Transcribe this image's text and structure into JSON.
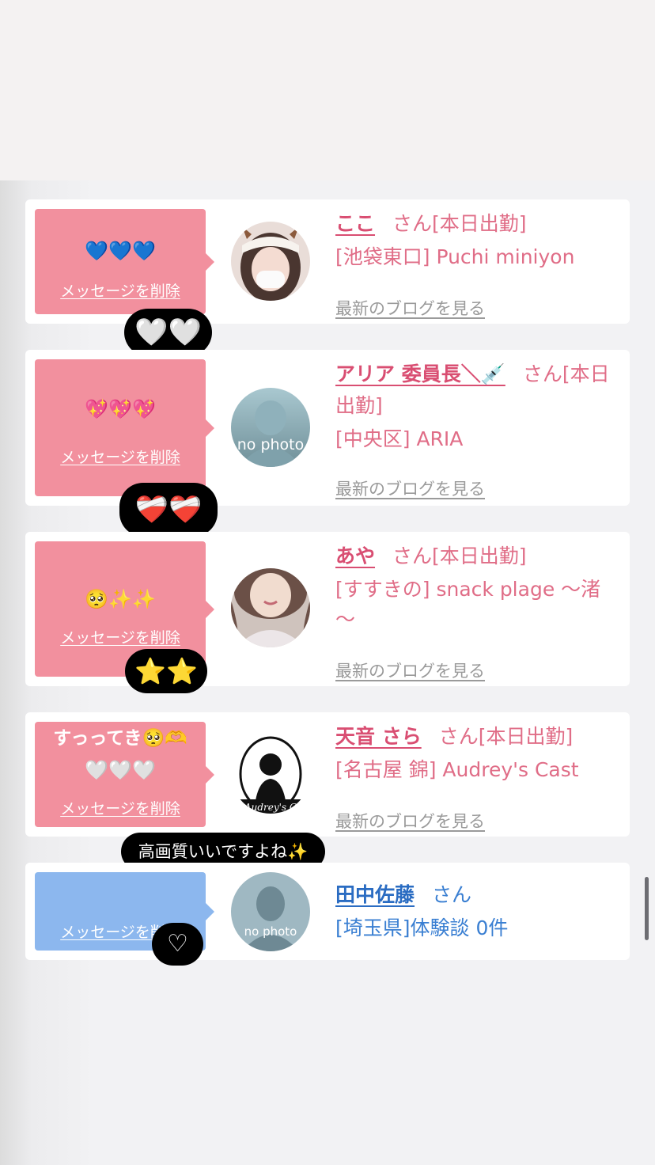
{
  "cards": [
    {
      "message": "💙💙💙",
      "delete_label": "メッセージを削除",
      "name": "ここ",
      "suffix": "さん[本日出勤]",
      "shop": "[池袋東口] Puchi miniyon",
      "blog_link": "最新のブログを見る",
      "reaction": "🤍🤍",
      "avatar": "photo-avatar"
    },
    {
      "message": "💖💖💖",
      "delete_label": "メッセージを削除",
      "name": "アリア 委員長＼💉",
      "suffix": "さん[本日",
      "suffix_cont": "出勤]",
      "shop": "[中央区] ARIA",
      "blog_link": "最新のブログを見る",
      "reaction": "❤️‍🩹❤️‍🩹",
      "avatar_text": "no photo"
    },
    {
      "message": "🥺✨✨",
      "delete_label": "メッセージを削除",
      "name": "あや",
      "suffix": "さん[本日出勤]",
      "shop": "[すすきの] snack plage 〜渚",
      "shop_cont": "〜",
      "blog_link": "最新のブログを見る",
      "reaction": "⭐⭐",
      "avatar": "photo-avatar"
    },
    {
      "message": "すっってき🥺🫶",
      "message_line2": "🤍🤍🤍",
      "delete_label": "メッセージを削除",
      "name": "天音 さら",
      "suffix": "さん[本日出勤]",
      "shop": "[名古屋 錦] Audrey's Cast",
      "blog_link": "最新のブログを見る",
      "reaction": "高画質いいですよね✨",
      "avatar_text": "Audrey's C"
    },
    {
      "message": "",
      "delete_label": "メッセージを削除",
      "name": "田中佐藤",
      "suffix": "さん",
      "shop": "[埼玉県]体験談 0件",
      "reaction": "♡",
      "avatar_text": "no photo"
    }
  ],
  "colors": {
    "pink_bubble": "#f2909e",
    "blue_bubble": "#8cb7ee",
    "pink_text": "#d94e72",
    "blue_text": "#2a6cc2"
  }
}
